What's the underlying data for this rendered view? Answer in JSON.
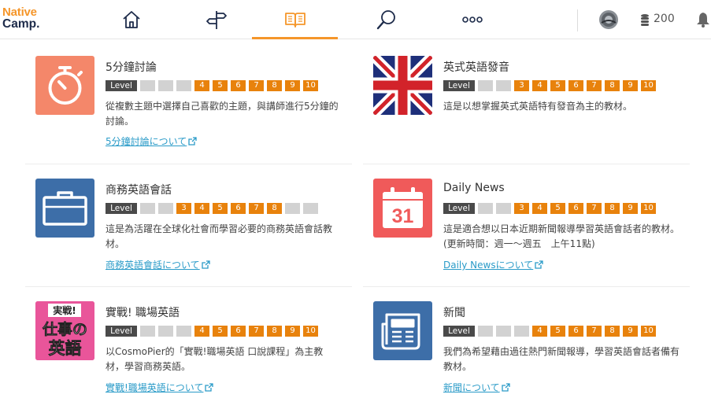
{
  "header": {
    "logo_line1": "Native",
    "logo_line2": "Camp.",
    "nav": [
      "home-icon",
      "signpost-icon",
      "book-icon",
      "search-icon",
      "more-icon"
    ],
    "active_tab": "book-icon",
    "coins": "200",
    "accent": "#f5962a"
  },
  "courses": [
    {
      "title": "5分鐘討論",
      "thumb": "stopwatch-icon",
      "thumb_color": "#f4876a",
      "levels": [
        false,
        false,
        false,
        true,
        true,
        true,
        true,
        true,
        true
      ],
      "level_labels": [
        "",
        "",
        "",
        "4",
        "5",
        "6",
        "7",
        "8",
        "9",
        "10"
      ],
      "description": "從複數主題中選擇自己喜歡的主題，與講師進行5分鐘的討論。",
      "link": "5分鐘討論について"
    },
    {
      "title": "英式英語發音",
      "thumb": "union-jack-flag",
      "description": "這是以想掌握英式英語特有發音為主的教材。",
      "link": ""
    },
    {
      "title": "商務英語會話",
      "thumb": "briefcase-icon",
      "thumb_color": "#3d6ea8",
      "description": "這是為活躍在全球化社會而學習必要的商務英語會話教材。",
      "link": "商務英語會話について"
    },
    {
      "title": "Daily News",
      "thumb": "calendar-icon",
      "thumb_color": "#f05a5a",
      "calendar_day": "31",
      "description": "這是適合想以日本近期新聞報導學習英語會話者的教材。(更新時間：週一～週五　上午11點)",
      "link": "Daily Newsについて"
    },
    {
      "title": "實戰! 職場英語",
      "thumb": "jissen-book-cover",
      "thumb_color": "#e9559a",
      "cover_line1": "実戦!",
      "cover_line2": "仕事の",
      "cover_line3": "英語",
      "description": "以CosmoPier的「實戰!職場英語 口說課程」為主教材，學習商務英語。",
      "link": "實戰!職場英語について"
    },
    {
      "title": "新聞",
      "thumb": "newspaper-icon",
      "thumb_color": "#3d6ea8",
      "description": "我們為希望藉由過往熱門新聞報導，學習英語會話者備有教材。",
      "link": "新聞について"
    }
  ],
  "level_badges": {
    "label": "Level",
    "c0": [
      "",
      "",
      "",
      "4",
      "5",
      "6",
      "7",
      "8",
      "9",
      "10"
    ],
    "c1": [
      "",
      "",
      "3",
      "4",
      "5",
      "6",
      "7",
      "8",
      "9",
      "10"
    ],
    "c2": [
      "",
      "",
      "3",
      "4",
      "5",
      "6",
      "7",
      "8",
      "",
      ""
    ],
    "c3": [
      "",
      "",
      "3",
      "4",
      "5",
      "6",
      "7",
      "8",
      "9",
      "10"
    ],
    "c4": [
      "",
      "",
      "",
      "4",
      "5",
      "6",
      "7",
      "8",
      "9",
      "10"
    ],
    "c5": [
      "",
      "",
      "",
      "4",
      "5",
      "6",
      "7",
      "8",
      "9",
      "10"
    ]
  },
  "colors": {
    "level_active": "#e8820c",
    "level_inactive": "#d2d2d2",
    "level_label": "#4a4a4a",
    "link": "#2a9bc8"
  }
}
